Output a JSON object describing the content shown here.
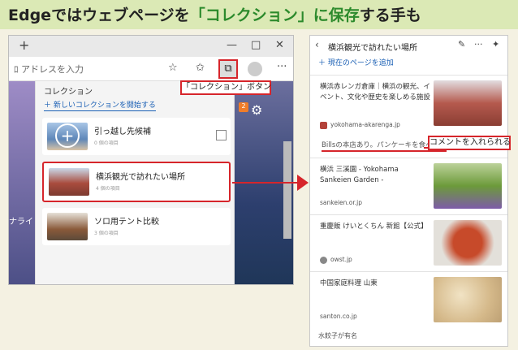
{
  "title": {
    "prefix": "Edgeではウェブページを",
    "highlight": "「コレクション」に保存",
    "suffix": "する手も"
  },
  "browser": {
    "new_tab": "+",
    "win_min": "—",
    "win_max": "□",
    "win_close": "✕",
    "address": "ﾛ アドレスを入力",
    "page_left_text": "ナライ",
    "badge": "2",
    "panel": {
      "title": "コレクション",
      "new_collection": "新しいコレクションを開始する",
      "cards": [
        {
          "name": "引っ越し先候補",
          "count": "0 個の項目"
        },
        {
          "name": "横浜観光で訪れたい場所",
          "count": "4 個の項目"
        },
        {
          "name": "ソロ用テント比較",
          "count": "3 個の項目"
        }
      ]
    }
  },
  "callouts": {
    "collection_button": "「コレクション」ボタン",
    "comment": "コメントを入れられる"
  },
  "collection_panel": {
    "title": "横浜観光で訪れたい場所",
    "add_current": "現在のページを追加",
    "items": [
      {
        "title": "横浜赤レンガ倉庫｜横浜の観光、イベント、文化や歴史を楽しめる施設",
        "source": "yokohama-akarenga.jp"
      },
      {
        "title": "横浜 三溪園 - Yokohama Sankeien Garden -",
        "source": "sankeien.or.jp"
      },
      {
        "title": "重慶飯 けいとくちん 新館【公式】",
        "source": "owst.jp"
      },
      {
        "title": "中国家庭料理 山東",
        "source": "santon.co.jp"
      }
    ],
    "comment": "Billsの本店あり。パンケーキを食べたい",
    "footer_note": "水餃子が有名"
  },
  "colors": {
    "accent_red": "#d6252b",
    "link_blue": "#1a5fb4",
    "title_bg": "#dbe9b5",
    "title_green": "#2c8a2c"
  }
}
